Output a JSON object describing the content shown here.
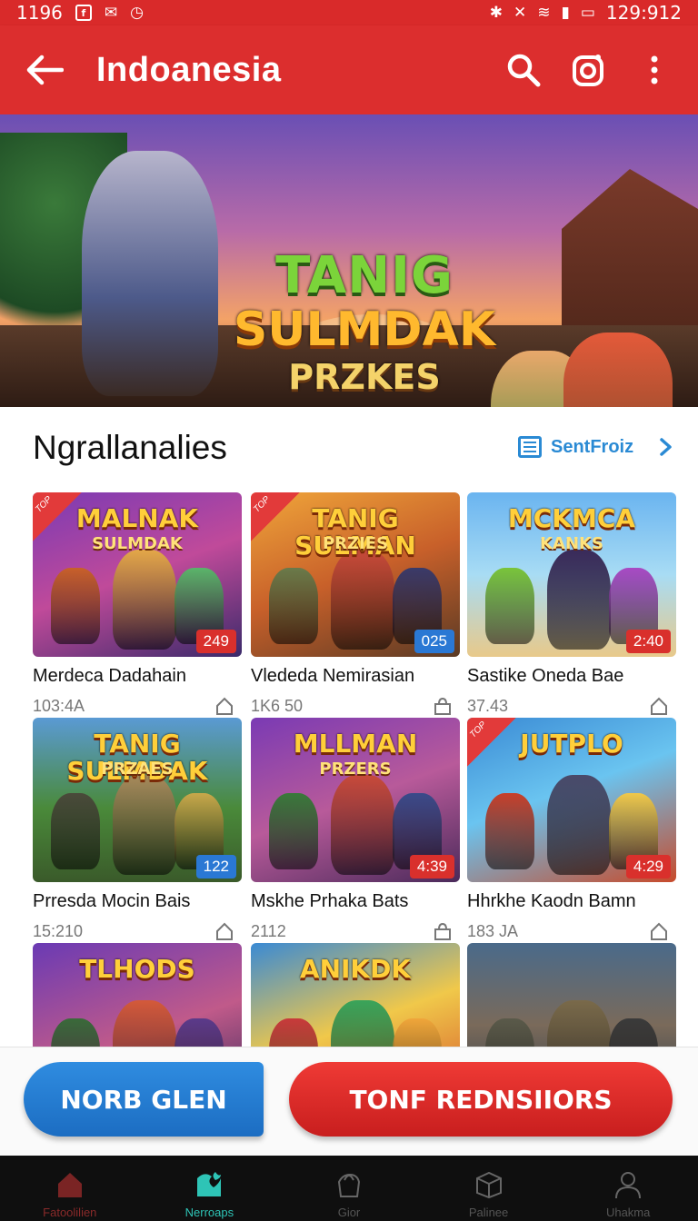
{
  "status_bar": {
    "time_left": "1196",
    "time_right": "129:912"
  },
  "app_bar": {
    "title": "Indoanesia",
    "back_icon": "back-arrow-icon",
    "search_icon": "search-icon",
    "camera_icon": "camera-icon",
    "more_icon": "more-vert-icon"
  },
  "banner": {
    "title_line1": "TANIG",
    "title_line2": "SULMDAK",
    "title_line3": "PRZKES",
    "slides": 5,
    "active_slide_index": 1
  },
  "section": {
    "title": "Ngrallanalies",
    "link_label": "SentFroiz",
    "link_icon": "list-icon",
    "chevron_icon": "chevron-right-icon"
  },
  "games": [
    {
      "thumb_title": "MALNAK",
      "thumb_sub": "SULMDAK",
      "badge": "249",
      "badge_color": "#d9302c",
      "ribbon": "TOP",
      "name": "Merdeca Dadahain",
      "meta": "103:4A",
      "meta_icon": "home-outline-icon"
    },
    {
      "thumb_title": "TANIG SULMAN",
      "thumb_sub": "PRZIES",
      "badge": "025",
      "badge_color": "#2a78d4",
      "ribbon": "TOP",
      "name": "Vlededa Nemirasian",
      "meta": "1K6 50",
      "meta_icon": "bag-icon"
    },
    {
      "thumb_title": "MCKMCA",
      "thumb_sub": "KANKS",
      "badge": "2:40",
      "badge_color": "#d9302c",
      "ribbon": "",
      "name": "Sastike Oneda Bae",
      "meta": "37.43",
      "meta_icon": "home-outline-icon"
    },
    {
      "thumb_title": "TANIG SULMDAK",
      "thumb_sub": "PRZAES",
      "badge": "122",
      "badge_color": "#2a78d4",
      "ribbon": "",
      "name": "Prresda Mocin Bais",
      "meta": "15:210",
      "meta_icon": "home-outline-icon"
    },
    {
      "thumb_title": "MLLMAN",
      "thumb_sub": "PRZERS",
      "badge": "4:39",
      "badge_color": "#d9302c",
      "ribbon": "",
      "name": "Mskhe Prhaka Bats",
      "meta": "2112",
      "meta_icon": "bag-icon"
    },
    {
      "thumb_title": "JUTPLO",
      "thumb_sub": "",
      "badge": "4:29",
      "badge_color": "#d9302c",
      "ribbon": "TOP",
      "name": "Hhrkhe Kaodn Bamn",
      "meta": "183 JA",
      "meta_icon": "home-outline-icon"
    },
    {
      "thumb_title": "TLHODS",
      "thumb_sub": "",
      "badge": "",
      "badge_color": "",
      "ribbon": "",
      "name": "",
      "meta": "",
      "meta_icon": ""
    },
    {
      "thumb_title": "ANIKDK",
      "thumb_sub": "",
      "badge": "",
      "badge_color": "",
      "ribbon": "",
      "name": "",
      "meta": "",
      "meta_icon": ""
    },
    {
      "thumb_title": "",
      "thumb_sub": "",
      "badge": "",
      "badge_color": "",
      "ribbon": "",
      "name": "",
      "meta": "",
      "meta_icon": ""
    }
  ],
  "actions": {
    "primary_blue": "NORB GLEN",
    "primary_red": "TONF REDNSIIORS"
  },
  "bottom_nav": [
    {
      "label": "Fatoolilien",
      "icon": "home-icon"
    },
    {
      "label": "Nerroaps",
      "icon": "moon-icon"
    },
    {
      "label": "Gior",
      "icon": "bag-outline-icon"
    },
    {
      "label": "Palinee",
      "icon": "box-icon"
    },
    {
      "label": "Uhakma",
      "icon": "user-icon"
    }
  ]
}
